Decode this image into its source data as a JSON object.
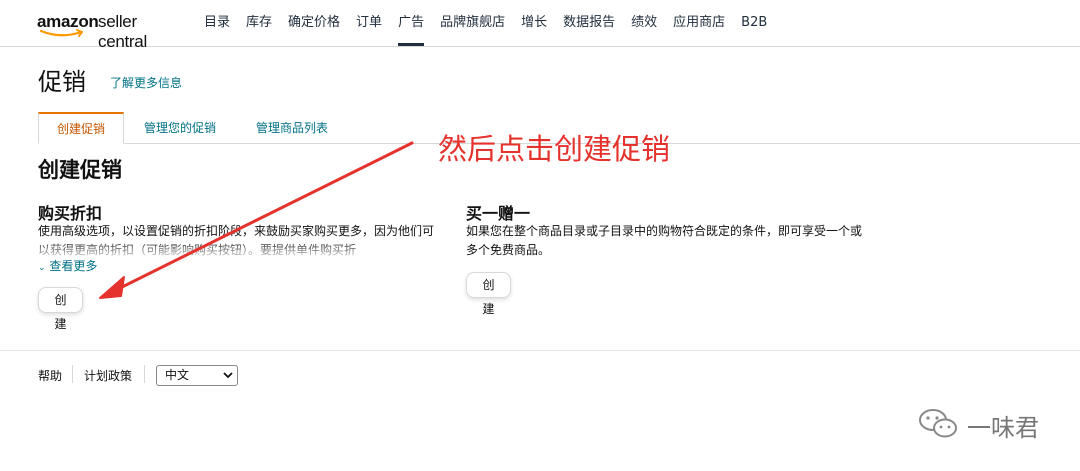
{
  "logo": {
    "brand": "amazon",
    "product": "seller central"
  },
  "nav": {
    "items": [
      "目录",
      "库存",
      "确定价格",
      "订单",
      "广告",
      "品牌旗舰店",
      "增长",
      "数据报告",
      "绩效",
      "应用商店",
      "B2B"
    ],
    "active_index": 4
  },
  "page": {
    "title": "促销",
    "learn_more": "了解更多信息"
  },
  "tabs": {
    "create": "创建促销",
    "manage": "管理您的促销",
    "products": "管理商品列表"
  },
  "section": {
    "title": "创建促销"
  },
  "cards": {
    "discount": {
      "title": "购买折扣",
      "desc": "使用高级选项，以设置促销的折扣阶段，来鼓励买家购买更多，因为他们可以获得更高的折扣（可能影响购买按钮）。要提供单件购买折",
      "see_more": "查看更多",
      "button": "创建"
    },
    "bogo": {
      "title": "买一赠一",
      "desc": "如果您在整个商品目录或子目录中的购物符合既定的条件，即可享受一个或多个免费商品。",
      "button": "创建"
    }
  },
  "footer": {
    "help": "帮助",
    "policy": "计划政策",
    "language": "中文"
  },
  "annotation": {
    "text": "然后点击创建促销",
    "color": "#e5322d"
  },
  "watermark": {
    "text": "一味君"
  },
  "colors": {
    "link": "#007185",
    "active_tab": "#c45500",
    "tab_accent": "#e77600"
  }
}
